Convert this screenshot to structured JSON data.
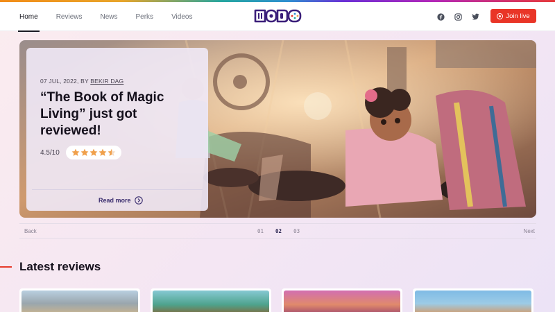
{
  "nav": {
    "items": [
      {
        "label": "Home",
        "active": true
      },
      {
        "label": "Reviews",
        "active": false
      },
      {
        "label": "News",
        "active": false
      },
      {
        "label": "Perks",
        "active": false
      },
      {
        "label": "Videos",
        "active": false
      }
    ]
  },
  "brand": {
    "logo_text": "wodo",
    "color": "#3b1f7a"
  },
  "social": {
    "icons": [
      "facebook-icon",
      "instagram-icon",
      "twitter-icon"
    ]
  },
  "join_button": {
    "label": "Join live",
    "color": "#e93527"
  },
  "hero": {
    "date_prefix": "07 JUL, 2022, BY",
    "author": "BEKIR DAG",
    "title": "“The Book of Magic Living” just got reviewed!",
    "score": "4.5/10",
    "star_rating": 4.5,
    "star_max": 5,
    "star_color": "#f0a04b",
    "read_more": "Read more"
  },
  "pager": {
    "back": "Back",
    "next": "Next",
    "pages": [
      "01",
      "02",
      "03"
    ],
    "current": "02"
  },
  "latest": {
    "title": "Latest reviews",
    "accent_color": "#e63a2a"
  }
}
